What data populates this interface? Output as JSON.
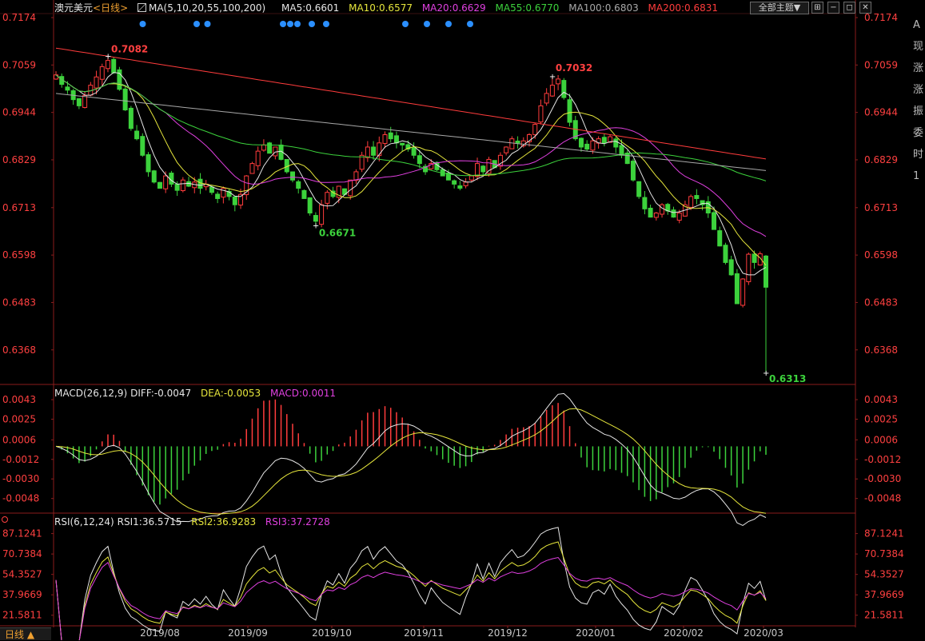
{
  "header": {
    "instrument": "澳元美元",
    "period": "<日线>",
    "ma_label": "MA(5,10,20,55,100,200)",
    "ma5": "MA5:0.6601",
    "ma10": "MA10:0.6577",
    "ma20": "MA20:0.6629",
    "ma55": "MA55:0.6770",
    "ma100": "MA100:0.6803",
    "ma200": "MA200:0.6831",
    "theme_button": "全部主题▼",
    "toolbar_icons": [
      "grid-icon",
      "minus-icon",
      "restore-icon",
      "close-icon"
    ]
  },
  "macd_header": {
    "label": "MACD(26,12,9)",
    "diff": "DIFF:-0.0047",
    "dea": "DEA:-0.0053",
    "macd": "MACD:0.0011"
  },
  "rsi_header": {
    "label": "RSI(6,12,24)",
    "rsi1": "RSI1:36.5715",
    "rsi2": "RSI2:36.9283",
    "rsi3": "RSI3:37.2728"
  },
  "period_tab": "日线 ▲",
  "side_panel": [
    "A",
    "现",
    "涨",
    "涨",
    "振",
    "委",
    "时",
    "1"
  ],
  "colors": {
    "up": "#ff3c3c",
    "down": "#3cd23c",
    "ma5": "#e6e6e6",
    "ma10": "#e6e63c",
    "ma20": "#e040e0",
    "ma55": "#3cd23c",
    "ma100": "#a8a8a8",
    "ma200": "#ff3c3c",
    "axis_text": "#ff4040",
    "marker": "#2b8fff"
  },
  "chart_data": [
    {
      "type": "candlestick",
      "ylim": [
        0.629,
        0.7174
      ],
      "y_ticks": [
        "0.7174",
        "0.7059",
        "0.6944",
        "0.6829",
        "0.6713",
        "0.6598",
        "0.6483",
        "0.6368"
      ],
      "x_labels": [
        "2019/08",
        "2019/09",
        "2019/10",
        "2019/11",
        "2019/12",
        "2020/01",
        "2020/02",
        "2020/03"
      ],
      "annotations": [
        {
          "text": "0.7082",
          "value": 0.7082,
          "kind": "high"
        },
        {
          "text": "0.6671",
          "value": 0.6671,
          "kind": "low"
        },
        {
          "text": "0.7032",
          "value": 0.7032,
          "kind": "high"
        },
        {
          "text": "0.6313",
          "value": 0.6313,
          "kind": "low"
        }
      ],
      "closes": [
        0.7035,
        0.7012,
        0.6998,
        0.6975,
        0.696,
        0.6985,
        0.701,
        0.703,
        0.7055,
        0.707,
        0.704,
        0.7,
        0.695,
        0.6905,
        0.688,
        0.684,
        0.68,
        0.6775,
        0.676,
        0.679,
        0.677,
        0.6755,
        0.678,
        0.6765,
        0.6775,
        0.676,
        0.677,
        0.675,
        0.6735,
        0.676,
        0.674,
        0.672,
        0.6745,
        0.679,
        0.682,
        0.685,
        0.6865,
        0.6845,
        0.686,
        0.683,
        0.68,
        0.678,
        0.676,
        0.6735,
        0.67,
        0.668,
        0.672,
        0.675,
        0.674,
        0.6765,
        0.6745,
        0.678,
        0.68,
        0.684,
        0.686,
        0.684,
        0.687,
        0.689,
        0.688,
        0.687,
        0.6865,
        0.6855,
        0.684,
        0.682,
        0.68,
        0.682,
        0.6805,
        0.679,
        0.678,
        0.677,
        0.676,
        0.6775,
        0.679,
        0.682,
        0.68,
        0.683,
        0.681,
        0.684,
        0.686,
        0.688,
        0.687,
        0.6875,
        0.689,
        0.6915,
        0.696,
        0.699,
        0.701,
        0.7025,
        0.698,
        0.692,
        0.688,
        0.686,
        0.6855,
        0.6875,
        0.688,
        0.687,
        0.6885,
        0.686,
        0.684,
        0.682,
        0.678,
        0.674,
        0.671,
        0.669,
        0.67,
        0.672,
        0.6705,
        0.669,
        0.67,
        0.672,
        0.674,
        0.6735,
        0.672,
        0.67,
        0.666,
        0.662,
        0.658,
        0.655,
        0.648,
        0.654,
        0.66,
        0.658,
        0.6601,
        0.652
      ],
      "low_point": 0.6313,
      "markers_top": 14
    },
    {
      "type": "macd",
      "y_ticks": [
        "0.0043",
        "0.0025",
        "0.0006",
        "-0.0012",
        "-0.0030",
        "-0.0048"
      ],
      "ylim": [
        -0.006,
        0.0043
      ],
      "last": {
        "diff": -0.0047,
        "dea": -0.0053,
        "macd": 0.0011
      }
    },
    {
      "type": "rsi",
      "y_ticks": [
        "87.1241",
        "70.7384",
        "54.3527",
        "37.9669",
        "21.5811"
      ],
      "ylim": [
        15,
        92
      ],
      "last": {
        "rsi1": 36.5715,
        "rsi2": 36.9283,
        "rsi3": 37.2728
      }
    }
  ]
}
